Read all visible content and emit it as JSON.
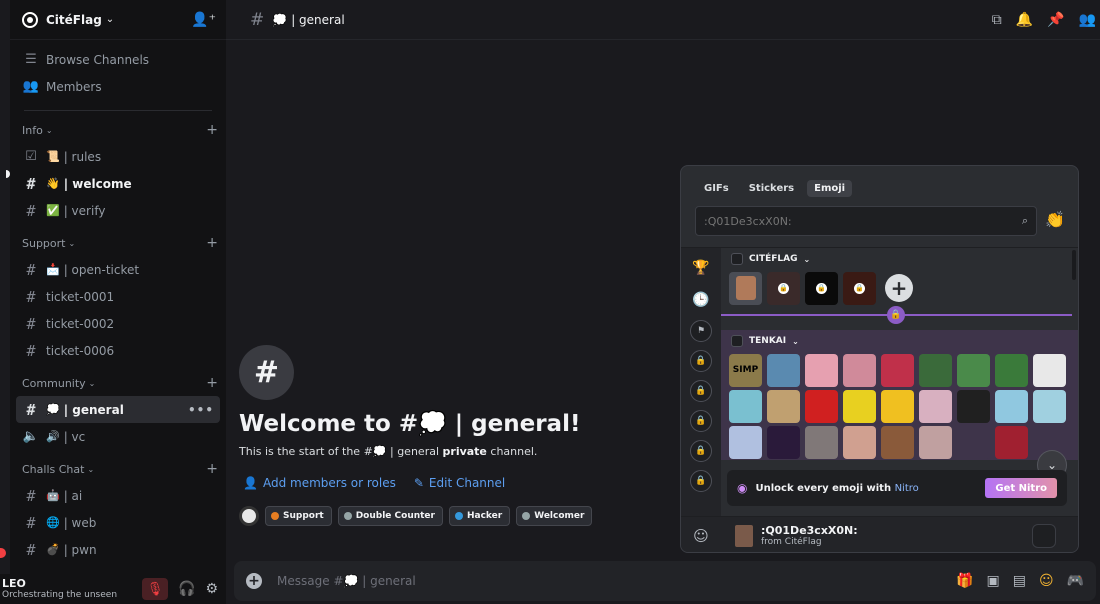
{
  "server": {
    "name": "CitéFlag"
  },
  "nav": {
    "browse": "Browse Channels",
    "members": "Members"
  },
  "categories": {
    "info": "Info",
    "support": "Support",
    "community": "Community",
    "challs": "Challs Chat"
  },
  "channels": {
    "rules": {
      "emoji": "📜",
      "name": "| rules"
    },
    "welcome": {
      "emoji": "👋",
      "name": "| welcome"
    },
    "verify": {
      "emoji": "✅",
      "name": "| verify"
    },
    "open_ticket": {
      "emoji": "📩",
      "name": "| open-ticket"
    },
    "ticket1": {
      "name": "ticket-0001"
    },
    "ticket2": {
      "name": "ticket-0002"
    },
    "ticket6": {
      "name": "ticket-0006"
    },
    "general": {
      "emoji": "💭",
      "name": "| general"
    },
    "vc": {
      "emoji": "🔊",
      "name": "| vc"
    },
    "ai": {
      "emoji": "🤖",
      "name": "| ai"
    },
    "web": {
      "emoji": "🌐",
      "name": "| web"
    },
    "pwn": {
      "emoji": "💣",
      "name": "| pwn"
    }
  },
  "user": {
    "name": "LEO",
    "status": "Orchestrating the unseen"
  },
  "topbar": {
    "emoji": "💭",
    "title": "| general"
  },
  "welcome": {
    "title_prefix": "Welcome to #",
    "title_emoji": "💭",
    "title_suffix": " | general!",
    "sub_prefix": "This is the start of the #",
    "sub_emoji": "💭",
    "sub_channel": " | general ",
    "sub_private": "private",
    "sub_suffix": " channel.",
    "add_members": "Add members or roles",
    "edit_channel": "Edit Channel"
  },
  "roles": [
    {
      "name": "Support",
      "color": "#e67e22"
    },
    {
      "name": "Double Counter",
      "color": "#95a5a6"
    },
    {
      "name": "Hacker",
      "color": "#3498db"
    },
    {
      "name": "Welcomer",
      "color": "#95a5a6"
    }
  ],
  "composer": {
    "placeholder": "Message #💭 | general"
  },
  "picker": {
    "tabs": [
      "GIFs",
      "Stickers",
      "Emoji"
    ],
    "active_tab": "Emoji",
    "search_placeholder": ":Q01De3cxX0N:",
    "sections": {
      "citeflag": "CITÉFLAG",
      "tenkai": "TENKAI"
    },
    "nitro_text": "Unlock every emoji with ",
    "nitro_link": "Nitro",
    "get_nitro": "Get Nitro",
    "footer_name": ":Q01De3cxX0N:",
    "footer_source": "from CitéFlag"
  },
  "colors": {
    "accent_link": "#5c9ef0",
    "nitro_purple": "#8c5cc6",
    "mute_red": "#f23f42"
  }
}
